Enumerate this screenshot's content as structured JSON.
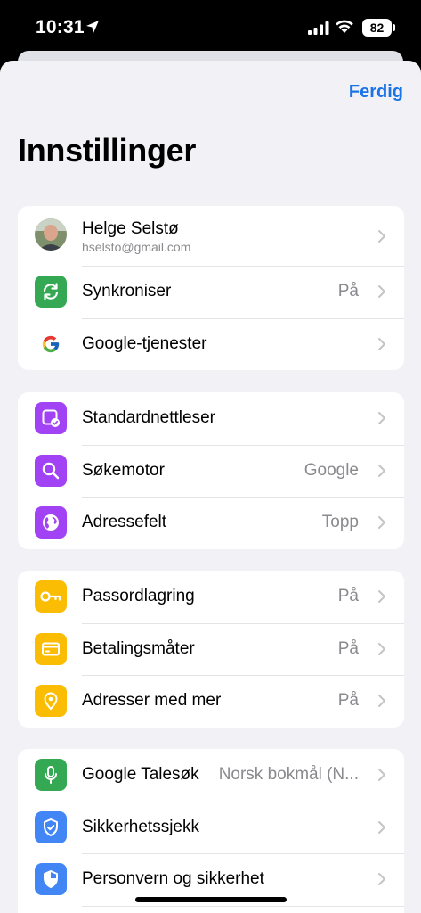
{
  "status": {
    "time": "10:31",
    "battery": "82"
  },
  "header": {
    "done_label": "Ferdig",
    "title": "Innstillinger"
  },
  "account": {
    "name": "Helge Selstø",
    "email": "hselsto@gmail.com"
  },
  "groups": [
    [
      {
        "label": "Synkroniser",
        "value": "På",
        "icon": "sync-icon",
        "color": "#34a853"
      },
      {
        "label": "Google-tjenester",
        "value": "",
        "icon": "google-icon",
        "color": "#ffffff"
      }
    ],
    [
      {
        "label": "Standardnettleser",
        "value": "",
        "icon": "default-browser-icon",
        "color": "#a142f4"
      },
      {
        "label": "Søkemotor",
        "value": "Google",
        "icon": "search-icon",
        "color": "#a142f4"
      },
      {
        "label": "Adressefelt",
        "value": "Topp",
        "icon": "globe-icon",
        "color": "#a142f4"
      }
    ],
    [
      {
        "label": "Passordlagring",
        "value": "På",
        "icon": "key-icon",
        "color": "#fbbc04"
      },
      {
        "label": "Betalingsmåter",
        "value": "På",
        "icon": "card-icon",
        "color": "#fbbc04"
      },
      {
        "label": "Adresser med mer",
        "value": "På",
        "icon": "location-pin-icon",
        "color": "#fbbc04"
      }
    ],
    [
      {
        "label": "Google Talesøk",
        "value": "Norsk bokmål (N...",
        "icon": "microphone-icon",
        "color": "#34a853"
      },
      {
        "label": "Sikkerhetssjekk",
        "value": "",
        "icon": "shield-check-icon",
        "color": "#4285f4"
      },
      {
        "label": "Personvern og sikkerhet",
        "value": "",
        "icon": "shield-icon",
        "color": "#4285f4"
      }
    ]
  ]
}
